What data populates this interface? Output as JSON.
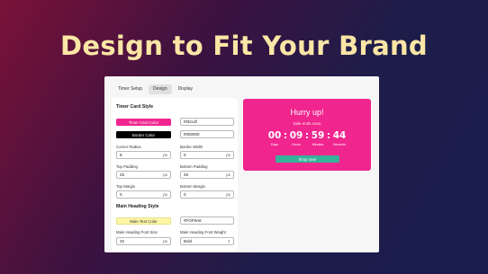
{
  "hero": {
    "title": "Design to Fit Your Brand"
  },
  "tabs": [
    "Timer Setup",
    "Design",
    "Display"
  ],
  "timer_card_style": {
    "title": "Timer Card Style",
    "card_color_label": "Timer Card Color",
    "card_color_value": "#f32cdf",
    "card_color": "#f0258e",
    "border_color_label": "Border Color",
    "border_color_value": "#000000",
    "border_color": "#000000",
    "corner_radius_label": "Corner Radius",
    "corner_radius_value": "8",
    "border_width_label": "Border Width",
    "border_width_value": "0",
    "top_padding_label": "Top Padding",
    "top_padding_value": "25",
    "bottom_padding_label": "Bottom Padding",
    "bottom_padding_value": "25",
    "top_margin_label": "Top Margin",
    "top_margin_value": "0",
    "bottom_margin_label": "Bottom Margin",
    "bottom_margin_value": "0",
    "unit": "px"
  },
  "main_heading_style": {
    "title": "Main Heading Style",
    "text_color_label": "Main Text Color",
    "text_color_value": "#FOF9A8",
    "text_color": "#fdf6a8",
    "font_size_label": "Main Heading Font Size",
    "font_size_value": "32",
    "font_weight_label": "Main Heading Font Weight",
    "font_weight_value": "Bold",
    "unit": "px"
  },
  "preview": {
    "title": "Hurry up!",
    "subtitle": "Sale ends soon",
    "days": "00",
    "hours": "09",
    "minutes": "59",
    "seconds": "44",
    "separator": ":",
    "days_label": "Days",
    "hours_label": "Hours",
    "minutes_label": "Minutes",
    "seconds_label": "Seconds",
    "button_label": "Shop now!"
  }
}
